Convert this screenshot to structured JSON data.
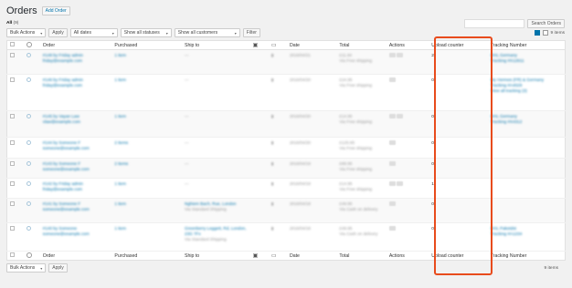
{
  "header": {
    "title": "Orders",
    "add_button": "Add Order"
  },
  "subsub": {
    "all_label": "All",
    "all_count": "(9)"
  },
  "search": {
    "placeholder": "",
    "button": "Search Orders"
  },
  "tablenav": {
    "bulk_actions": "Bulk Actions",
    "apply": "Apply",
    "dates": "All dates",
    "statuses": "Show all statuses",
    "customers": "Show all customers",
    "filter": "Filter",
    "items_count": "9 items"
  },
  "columns": {
    "order": "Order",
    "purchased": "Purchased",
    "ship_to": "Ship to",
    "date": "Date",
    "total": "Total",
    "actions": "Actions",
    "upload_counter": "Upload counter",
    "tracking_number": "Tracking Number"
  },
  "rows": [
    {
      "order": "#148 by Friday admin",
      "email": "friday@example.com",
      "purchased": "1 item",
      "ship_to": "—",
      "date": "2016/04/21",
      "total": "£11.94",
      "total_sub": "Via Free shipping",
      "upload_counter": "2",
      "tracking": "DHL Germany",
      "tracking2": "Tracking #X12911"
    },
    {
      "order": "#146 by Friday admin",
      "email": "friday@example.com",
      "purchased": "1 item",
      "ship_to": "—",
      "date": "2016/04/20",
      "total": "£24.95",
      "total_sub": "Via Free shipping",
      "upload_counter": "0",
      "tracking": "My Hermes (FR) & Germany",
      "tracking2": "Tracking #A4029",
      "tracking3": "View all tracking (3)"
    },
    {
      "order": "#145 by Vayan Law",
      "email": "vlaw@example.com",
      "purchased": "1 item",
      "ship_to": "—",
      "date": "2016/04/20",
      "total": "£14.95",
      "total_sub": "Via Free shipping",
      "upload_counter": "0",
      "tracking": "DHL Germany",
      "tracking2": "Tracking #X4312"
    },
    {
      "order": "#144 by Someone F",
      "email": "someone@example.com",
      "purchased": "2 items",
      "ship_to": "—",
      "date": "2016/04/20",
      "total": "£125.95",
      "total_sub": "Via Free shipping",
      "upload_counter": "0",
      "tracking": "",
      "tracking2": ""
    },
    {
      "order": "#143 by Someone F",
      "email": "someone@example.com",
      "purchased": "2 items",
      "ship_to": "—",
      "date": "2016/04/19",
      "total": "£89.95",
      "total_sub": "Via Free shipping",
      "upload_counter": "0",
      "tracking": "",
      "tracking2": ""
    },
    {
      "order": "#142 by Friday admin",
      "email": "friday@example.com",
      "purchased": "1 item",
      "ship_to": "—",
      "date": "2016/04/19",
      "total": "£14.95",
      "total_sub": "Via Free shipping",
      "upload_counter": "1",
      "tracking": "",
      "tracking2": ""
    },
    {
      "order": "#141 by Someone F",
      "email": "someone@example.com",
      "purchased": "1 item",
      "ship_to": "Nghiem Bach, Rue, London",
      "ship_sub": "Via Standard Shipping",
      "date": "2016/04/18",
      "total": "£49.95",
      "total_sub": "Via Cash on delivery",
      "upload_counter": "0",
      "tracking": "",
      "tracking2": ""
    },
    {
      "order": "#140 by Someone",
      "email": "someone@example.com",
      "purchased": "1 item",
      "ship_to": "Greenberry Leggett, Rd, London, 23G 7Fx",
      "ship_sub": "Via Standard Shipping",
      "date": "2016/04/18",
      "total": "£49.95",
      "total_sub": "Via Cash on delivery",
      "upload_counter": "0",
      "tracking": "DHL Paketdst",
      "tracking2": "Tracking #A1234"
    }
  ],
  "colors": {
    "highlight": "#e84b1c",
    "link": "#0073aa"
  }
}
